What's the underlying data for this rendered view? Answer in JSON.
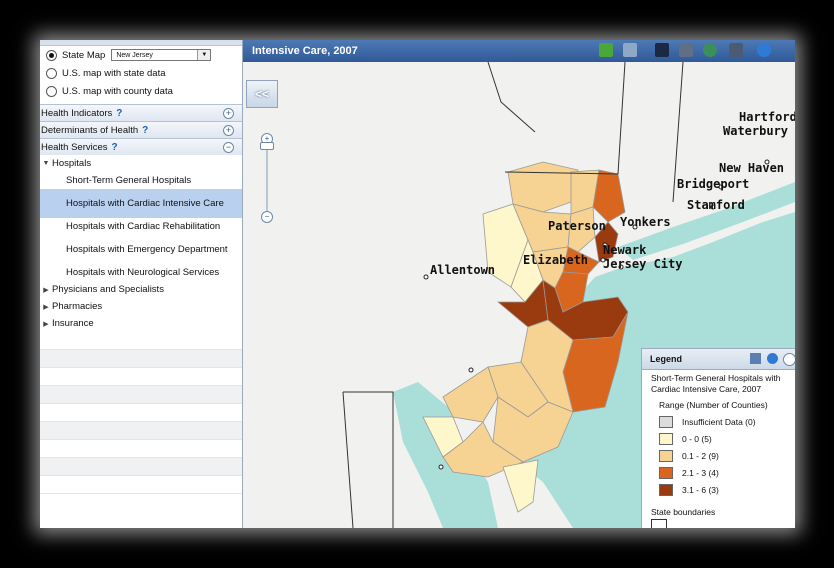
{
  "left_panel": {
    "map_options": [
      {
        "label": "State Map",
        "selected": true
      },
      {
        "label": "U.S. map with state data",
        "selected": false
      },
      {
        "label": "U.S. map with county data",
        "selected": false
      }
    ],
    "state_select_value": "New Jersey",
    "sections": {
      "health_indicators": {
        "label": "Health Indicators",
        "help": "?",
        "toggle": "+"
      },
      "determinants": {
        "label": "Determinants of Health",
        "help": "?",
        "toggle": "+"
      },
      "health_services": {
        "label": "Health Services",
        "help": "?",
        "toggle": "−"
      }
    },
    "tree": {
      "hospitals": "Hospitals",
      "hospital_items": [
        "Short-Term General Hospitals",
        "Hospitals with Cardiac Intensive Care",
        "Hospitals with Cardiac Rehabilitation",
        "Hospitals with Emergency Department",
        "Hospitals with Neurological Services"
      ],
      "collapsed": [
        "Physicians and Specialists",
        "Pharmacies",
        "Insurance"
      ]
    }
  },
  "map": {
    "title": "Intensive Care, 2007",
    "collapse_button": "<<",
    "zoom": {
      "in": "+",
      "out": "−"
    },
    "cities": [
      "Hartford",
      "Waterbury",
      "New Haven",
      "Bridgeport",
      "Stamford",
      "Yonkers",
      "Paterson",
      "Newark",
      "Elizabeth",
      "Jersey City",
      "Allentown"
    ],
    "colors": {
      "ocean": "#aadfd9",
      "land": "#f3f3f1",
      "c0": "#fff7cc",
      "c1": "#f6d293",
      "c2": "#d9661f",
      "c3": "#993a0f"
    }
  },
  "legend": {
    "title": "Legend",
    "subtitle": "Short-Term General Hospitals with Cardiac Intensive Care, 2007",
    "range_label": "Range (Number of Counties)",
    "items": [
      {
        "label": "Insufficient Data (0)",
        "color": "#dcdcdc"
      },
      {
        "label": "0 - 0 (5)",
        "color": "#fff7cc"
      },
      {
        "label": "0.1 - 2 (9)",
        "color": "#f6d293"
      },
      {
        "label": "2.1 - 3 (4)",
        "color": "#d9661f"
      },
      {
        "label": "3.1 - 6 (3)",
        "color": "#993a0f"
      }
    ],
    "state_boundaries": "State boundaries"
  }
}
